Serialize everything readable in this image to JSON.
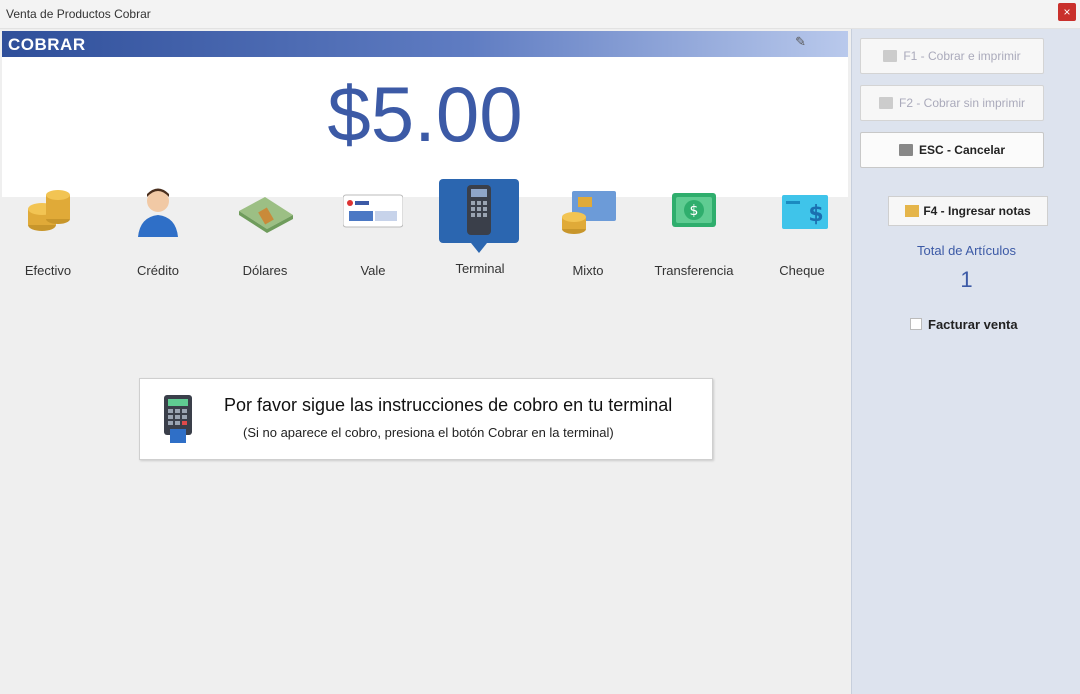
{
  "window": {
    "title": "Venta de Productos Cobrar",
    "close_label": "×"
  },
  "main": {
    "header_label": "COBRAR",
    "amount": "$5.00",
    "methods": [
      {
        "label": "Efectivo",
        "icon": "coins-icon"
      },
      {
        "label": "Crédito",
        "icon": "user-icon"
      },
      {
        "label": "Dólares",
        "icon": "banknotes-icon"
      },
      {
        "label": "Vale",
        "icon": "voucher-icon"
      },
      {
        "label": "Terminal",
        "icon": "card-terminal-icon",
        "selected": true
      },
      {
        "label": "Mixto",
        "icon": "mixed-payment-icon"
      },
      {
        "label": "Transferencia",
        "icon": "transfer-icon"
      },
      {
        "label": "Cheque",
        "icon": "check-icon"
      }
    ],
    "notice": {
      "message": "Por favor sigue las instrucciones de cobro en tu terminal",
      "submessage": "(Si no aparece el cobro, presiona el botón Cobrar en la terminal)"
    }
  },
  "side": {
    "buttons": [
      {
        "label": "F1 - Cobrar e imprimir",
        "enabled": false
      },
      {
        "label": "F2 - Cobrar sin imprimir",
        "enabled": false
      },
      {
        "label": "ESC - Cancelar",
        "enabled": true
      }
    ],
    "notes_label": "F4 - Ingresar notas",
    "total_label": "Total de Artículos",
    "total_value": "1",
    "invoice_label": "Facturar venta"
  },
  "colors": {
    "accent": "#3c5aa6",
    "header_start": "#2f4f9a",
    "selected_method": "#2b66b0"
  }
}
